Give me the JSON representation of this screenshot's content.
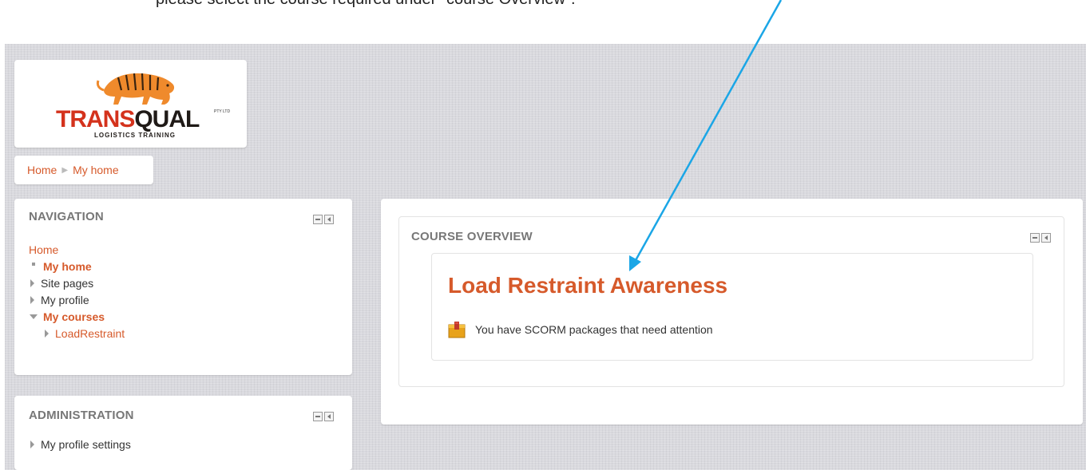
{
  "annotation": {
    "instruction_text": "please select the course required under \"course Overview\"."
  },
  "logo": {
    "brand_red": "TRANS",
    "brand_dark": "QUAL",
    "pty": "PTY LTD",
    "subtitle": "LOGISTICS TRAINING"
  },
  "breadcrumb": {
    "home": "Home",
    "current": "My home"
  },
  "navigation": {
    "title": "NAVIGATION",
    "items": [
      {
        "label": "Home"
      },
      {
        "label": "My home"
      },
      {
        "label": "Site pages"
      },
      {
        "label": "My profile"
      },
      {
        "label": "My courses"
      },
      {
        "label": "LoadRestraint"
      }
    ]
  },
  "administration": {
    "title": "ADMINISTRATION",
    "items": [
      {
        "label": "My profile settings"
      }
    ]
  },
  "course_overview": {
    "title": "COURSE OVERVIEW",
    "course_name": "Load Restraint Awareness",
    "notice": "You have SCORM packages that need attention"
  },
  "colors": {
    "accent_red": "#d65a2b",
    "arrow": "#1ba6e6",
    "page_bg": "#d9d9de"
  }
}
